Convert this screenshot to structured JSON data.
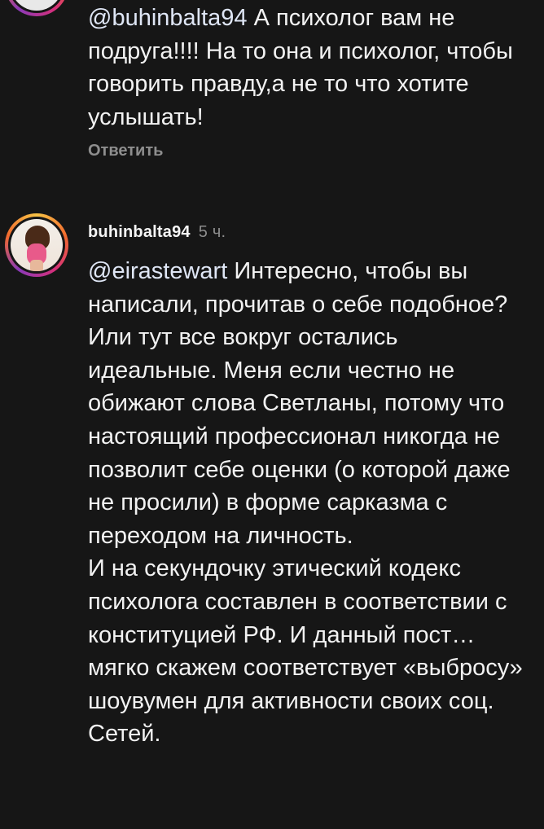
{
  "comments": [
    {
      "mention": "@buhinbalta94",
      "text": " А психолог вам не подруга!!!! На то она и психолог, чтобы говорить правду,а не  то что хотите услышать!",
      "reply_label": "Ответить"
    },
    {
      "username": "buhinbalta94",
      "timestamp": "5 ч.",
      "mention": "@eirastewart",
      "text": " Интересно, чтобы вы написали, прочитав о себе подобное? Или тут все вокруг остались идеальные. Меня если честно не обижают слова Светланы, потому что настоящий профессионал никогда не позволит себе оценки (о которой даже не просили) в форме сарказма с переходом на личность.\nИ на секундочку этический кодекс психолога составлен в соответствии с конституцией РФ. И данный пост… мягко скажем соответствует «выбросу» шоувумен для активности своих соц. Сетей."
    }
  ],
  "colors": {
    "background": "#161616",
    "text": "#f2f2f2",
    "muted": "#8e8e8e"
  }
}
